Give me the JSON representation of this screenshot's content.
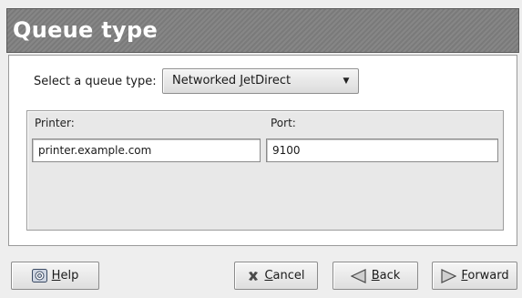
{
  "window": {
    "title": "Queue type"
  },
  "queue_type": {
    "label": "Select a queue type:",
    "selected_pre": "Networked ",
    "selected_mnemonic": "J",
    "selected_post": "etDirect"
  },
  "printer": {
    "label": "Printer:",
    "value": "printer.example.com"
  },
  "port": {
    "label": "Port:",
    "value": "9100"
  },
  "buttons": {
    "help": {
      "mnemonic": "H",
      "rest": "elp"
    },
    "cancel": {
      "mnemonic": "C",
      "rest": "ancel"
    },
    "back": {
      "mnemonic": "B",
      "rest": "ack"
    },
    "forward": {
      "mnemonic": "F",
      "rest": "orward"
    }
  }
}
